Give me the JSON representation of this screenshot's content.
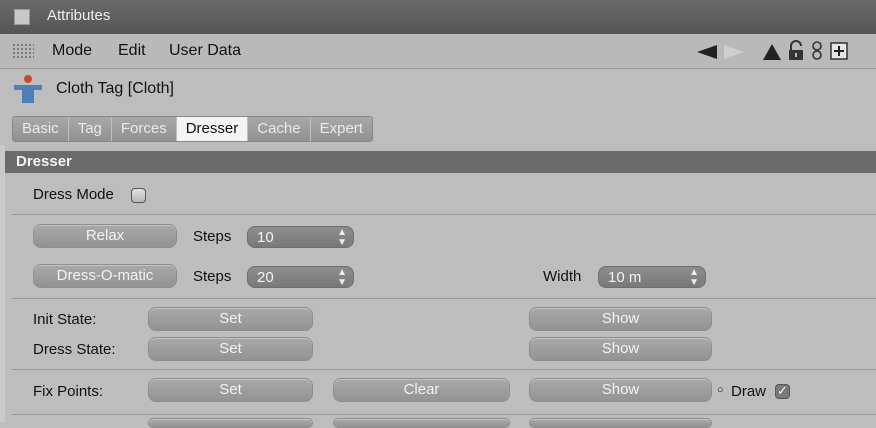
{
  "window": {
    "title": "Attributes"
  },
  "menu": {
    "items": [
      "Mode",
      "Edit",
      "User Data"
    ]
  },
  "toolbar_icons": [
    "back-arrow-icon",
    "forward-arrow-icon",
    "up-arrow-icon",
    "lock-icon",
    "link-icon",
    "new-panel-icon"
  ],
  "tag": {
    "label": "Cloth Tag [Cloth]"
  },
  "tabs": [
    "Basic",
    "Tag",
    "Forces",
    "Dresser",
    "Cache",
    "Expert"
  ],
  "active_tab": "Dresser",
  "section": {
    "title": "Dresser"
  },
  "dress_mode": {
    "label": "Dress Mode",
    "checked": false
  },
  "relax": {
    "button": "Relax",
    "steps_label": "Steps",
    "steps_value": "10"
  },
  "dressomatic": {
    "button": "Dress-O-matic",
    "steps_label": "Steps",
    "steps_value": "20",
    "width_label": "Width",
    "width_value": "10 m"
  },
  "init_state": {
    "label": "Init State:",
    "set": "Set",
    "show": "Show"
  },
  "dress_state": {
    "label": "Dress State:",
    "set": "Set",
    "show": "Show"
  },
  "fix_points": {
    "label": "Fix Points:",
    "set": "Set",
    "clear": "Clear",
    "show": "Show",
    "draw_label": "Draw",
    "draw_checked": true
  }
}
